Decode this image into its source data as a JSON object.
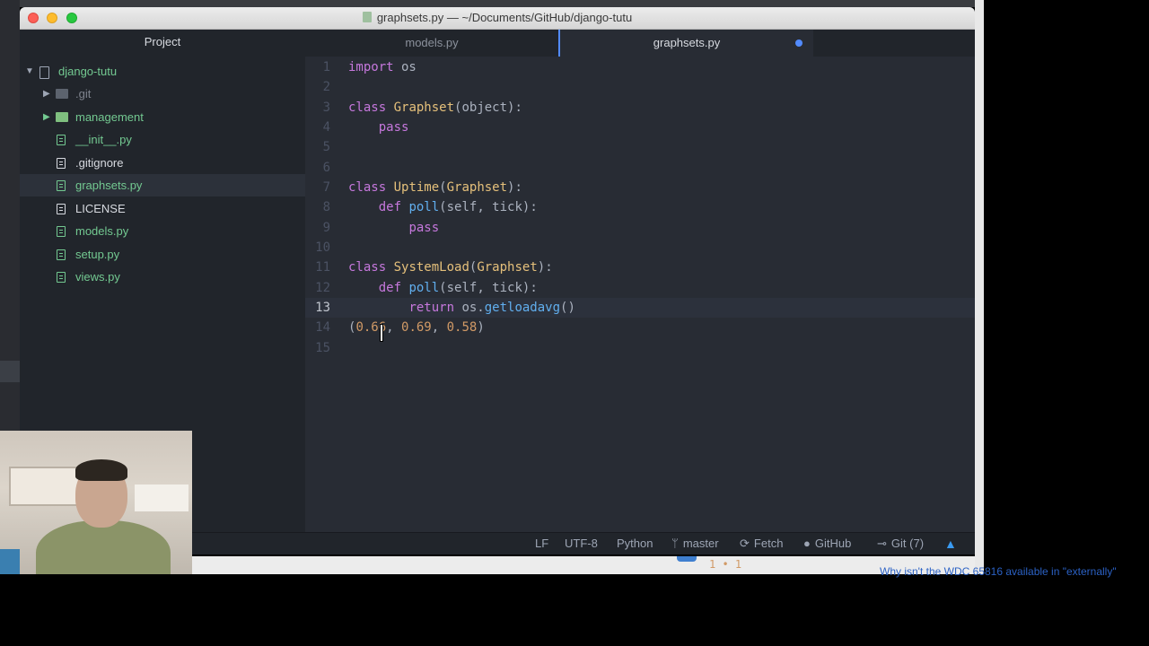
{
  "window": {
    "title": "graphsets.py — ~/Documents/GitHub/django-tutu"
  },
  "sidebar": {
    "header": "Project",
    "root": "django-tutu",
    "items": [
      {
        "label": ".git",
        "kind": "folder",
        "state": "ignored"
      },
      {
        "label": "management",
        "kind": "folder",
        "state": "new"
      },
      {
        "label": "__init__.py",
        "kind": "file",
        "state": "new"
      },
      {
        "label": ".gitignore",
        "kind": "file",
        "state": "plain"
      },
      {
        "label": "graphsets.py",
        "kind": "file",
        "state": "new",
        "selected": true
      },
      {
        "label": "LICENSE",
        "kind": "file",
        "state": "plain"
      },
      {
        "label": "models.py",
        "kind": "file",
        "state": "new"
      },
      {
        "label": "setup.py",
        "kind": "file",
        "state": "new"
      },
      {
        "label": "views.py",
        "kind": "file",
        "state": "new"
      }
    ]
  },
  "tabs": [
    {
      "label": "models.py",
      "active": false
    },
    {
      "label": "graphsets.py",
      "active": true,
      "modified": true
    }
  ],
  "code": {
    "current_line": 13,
    "lines": [
      {
        "n": "1",
        "t": "import os"
      },
      {
        "n": "2",
        "t": ""
      },
      {
        "n": "3",
        "t": "class Graphset(object):"
      },
      {
        "n": "4",
        "t": "    pass"
      },
      {
        "n": "5",
        "t": ""
      },
      {
        "n": "6",
        "t": ""
      },
      {
        "n": "7",
        "t": "class Uptime(Graphset):"
      },
      {
        "n": "8",
        "t": "    def poll(self, tick):"
      },
      {
        "n": "9",
        "t": "        pass"
      },
      {
        "n": "10",
        "t": ""
      },
      {
        "n": "11",
        "t": "class SystemLoad(Graphset):"
      },
      {
        "n": "12",
        "t": "    def poll(self, tick):"
      },
      {
        "n": "13",
        "t": "        return os.getloadavg()"
      },
      {
        "n": "14",
        "t": "(0.66, 0.69, 0.58)"
      },
      {
        "n": "15",
        "t": ""
      }
    ]
  },
  "statusbar": {
    "line_ending": "LF",
    "encoding": "UTF-8",
    "grammar": "Python",
    "branch": "master",
    "fetch": "Fetch",
    "github": "GitHub",
    "git": "Git (7)"
  },
  "background_app": {
    "count": "1 • 1",
    "link": "Why isn't the WDC 65816 available in \"externally\""
  },
  "colors": {
    "accent": "#528bff",
    "vcs_new": "#73c991",
    "keyword": "#c678dd",
    "function": "#61afef",
    "class_name": "#e5c07b",
    "number": "#d19a66"
  }
}
